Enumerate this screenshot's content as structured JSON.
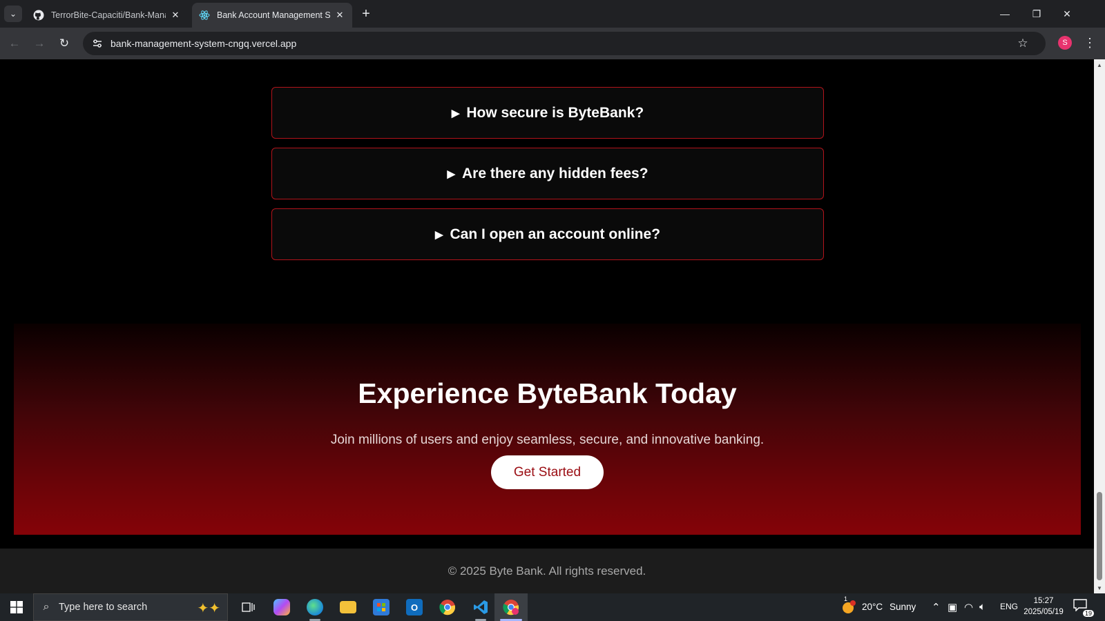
{
  "browser": {
    "tabs": [
      {
        "title": "TerrorBite-Capaciti/Bank-Manag",
        "favicon": "github-icon"
      },
      {
        "title": "Bank Account Management Sys",
        "favicon": "react-icon"
      }
    ],
    "url": "bank-management-system-cngq.vercel.app",
    "profile_initial": "S"
  },
  "faq": {
    "items": [
      {
        "question": "How secure is ByteBank?"
      },
      {
        "question": "Are there any hidden fees?"
      },
      {
        "question": "Can I open an account online?"
      }
    ]
  },
  "cta": {
    "title": "Experience ByteBank Today",
    "subtitle": "Join millions of users and enjoy seamless, secure, and innovative banking.",
    "button_label": "Get Started"
  },
  "footer": {
    "copyright": "© 2025 Byte Bank. All rights reserved."
  },
  "taskbar": {
    "search_placeholder": "Type here to search",
    "weather_temp": "20°C",
    "weather_desc": "Sunny",
    "language": "ENG",
    "time": "15:27",
    "date": "2025/05/19",
    "notification_count": "19",
    "weather_badge": "1"
  },
  "colors": {
    "accent_red": "#b3141b",
    "cta_button_text": "#9a0c12"
  }
}
